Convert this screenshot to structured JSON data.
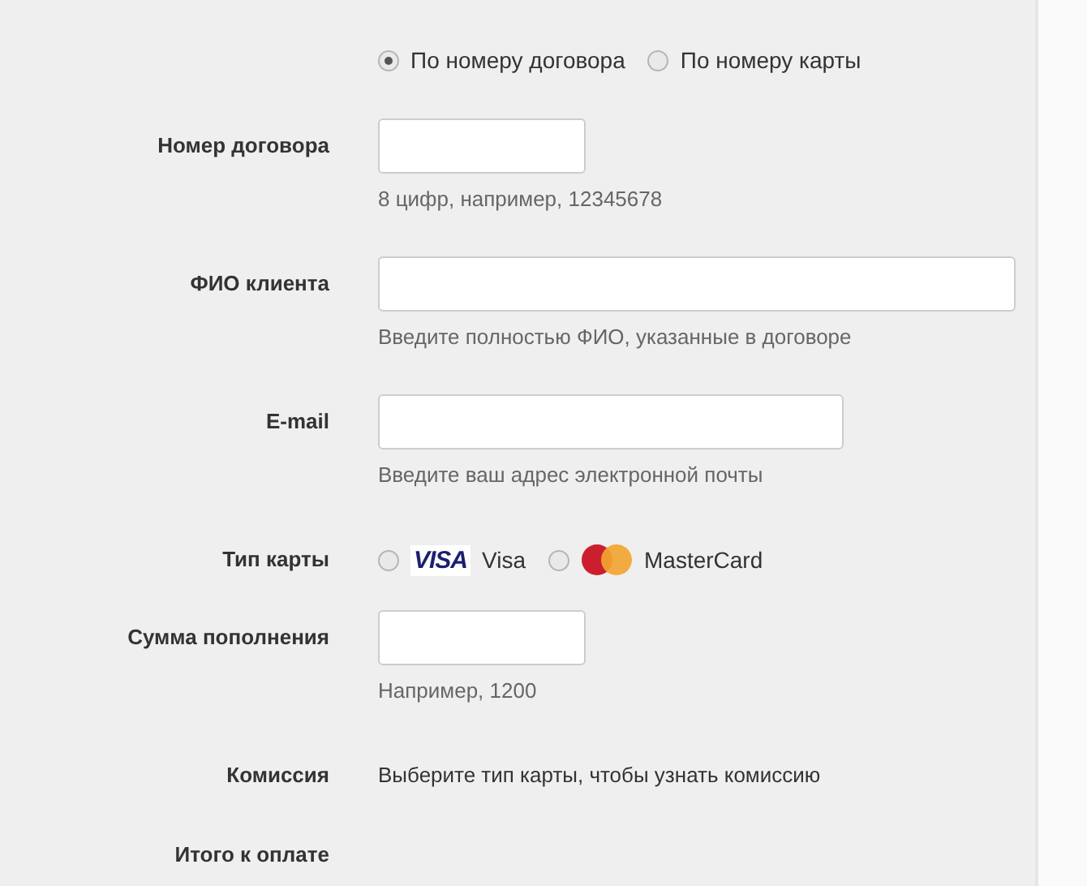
{
  "search_mode": [
    {
      "label": "По номеру договора",
      "selected": true
    },
    {
      "label": "По номеру карты",
      "selected": false
    }
  ],
  "rows": [
    {
      "kind": "input_short",
      "label": "Номер договора",
      "hint": "8 цифр, например, 12345678"
    },
    {
      "kind": "input_long",
      "label": "ФИО клиента",
      "hint": "Введите полностью ФИО, указанные в договоре"
    },
    {
      "kind": "input_medium",
      "label": "E-mail",
      "hint": "Введите ваш адрес электронной почты"
    },
    {
      "kind": "cards",
      "label": "Тип карты",
      "options": [
        {
          "kind": "visa",
          "logo_text": "VISA",
          "label": "Visa",
          "selected": false
        },
        {
          "kind": "mastercard",
          "label": "MasterCard",
          "selected": false
        }
      ]
    },
    {
      "kind": "input_short",
      "label": "Сумма пополнения",
      "hint": "Например, 1200"
    },
    {
      "kind": "text",
      "label": "Комиссия",
      "text": "Выберите тип карты, чтобы узнать комиссию"
    },
    {
      "kind": "text",
      "label": "Итого к оплате"
    }
  ]
}
